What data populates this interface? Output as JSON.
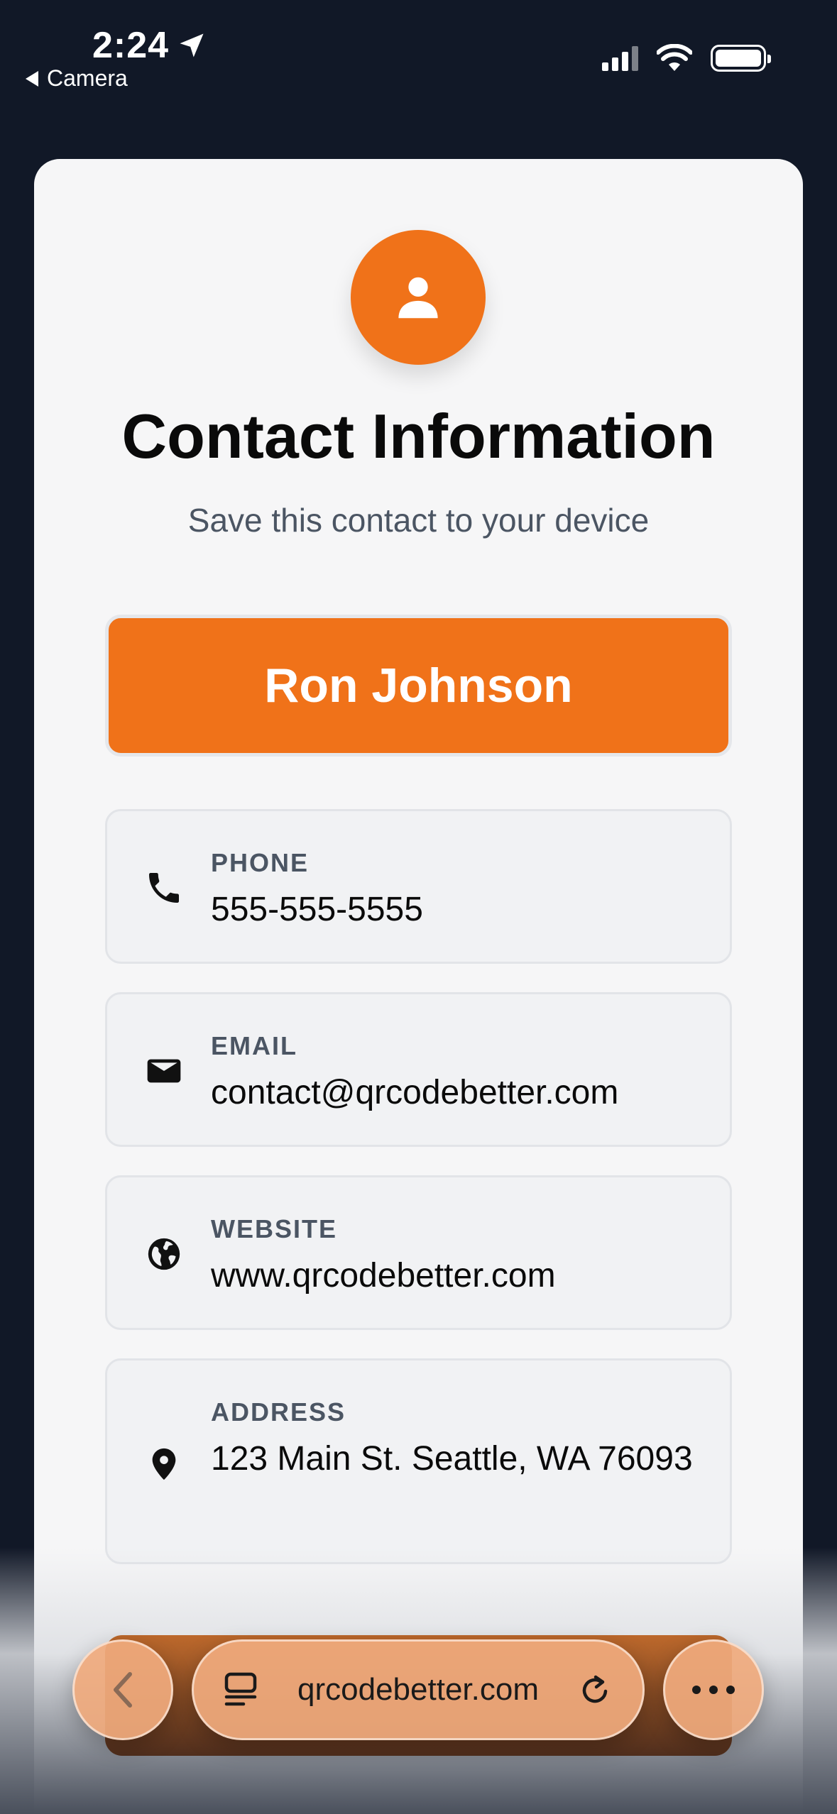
{
  "status_bar": {
    "time": "2:24",
    "back_label": "Camera"
  },
  "card": {
    "title": "Contact Information",
    "subtitle": "Save this contact to your device",
    "name": "Ron Johnson",
    "accent_color": "#f07219"
  },
  "fields": [
    {
      "label": "PHONE",
      "value": "555-555-5555",
      "icon": "phone-icon"
    },
    {
      "label": "EMAIL",
      "value": "contact@qrcodebetter.com",
      "icon": "mail-icon"
    },
    {
      "label": "WEBSITE",
      "value": "www.qrcodebetter.com",
      "icon": "globe-icon"
    },
    {
      "label": "ADDRESS",
      "value": "123 Main St. Seattle, WA 76093",
      "icon": "location-pin-icon"
    }
  ],
  "browser_bar": {
    "url": "qrcodebetter.com"
  }
}
